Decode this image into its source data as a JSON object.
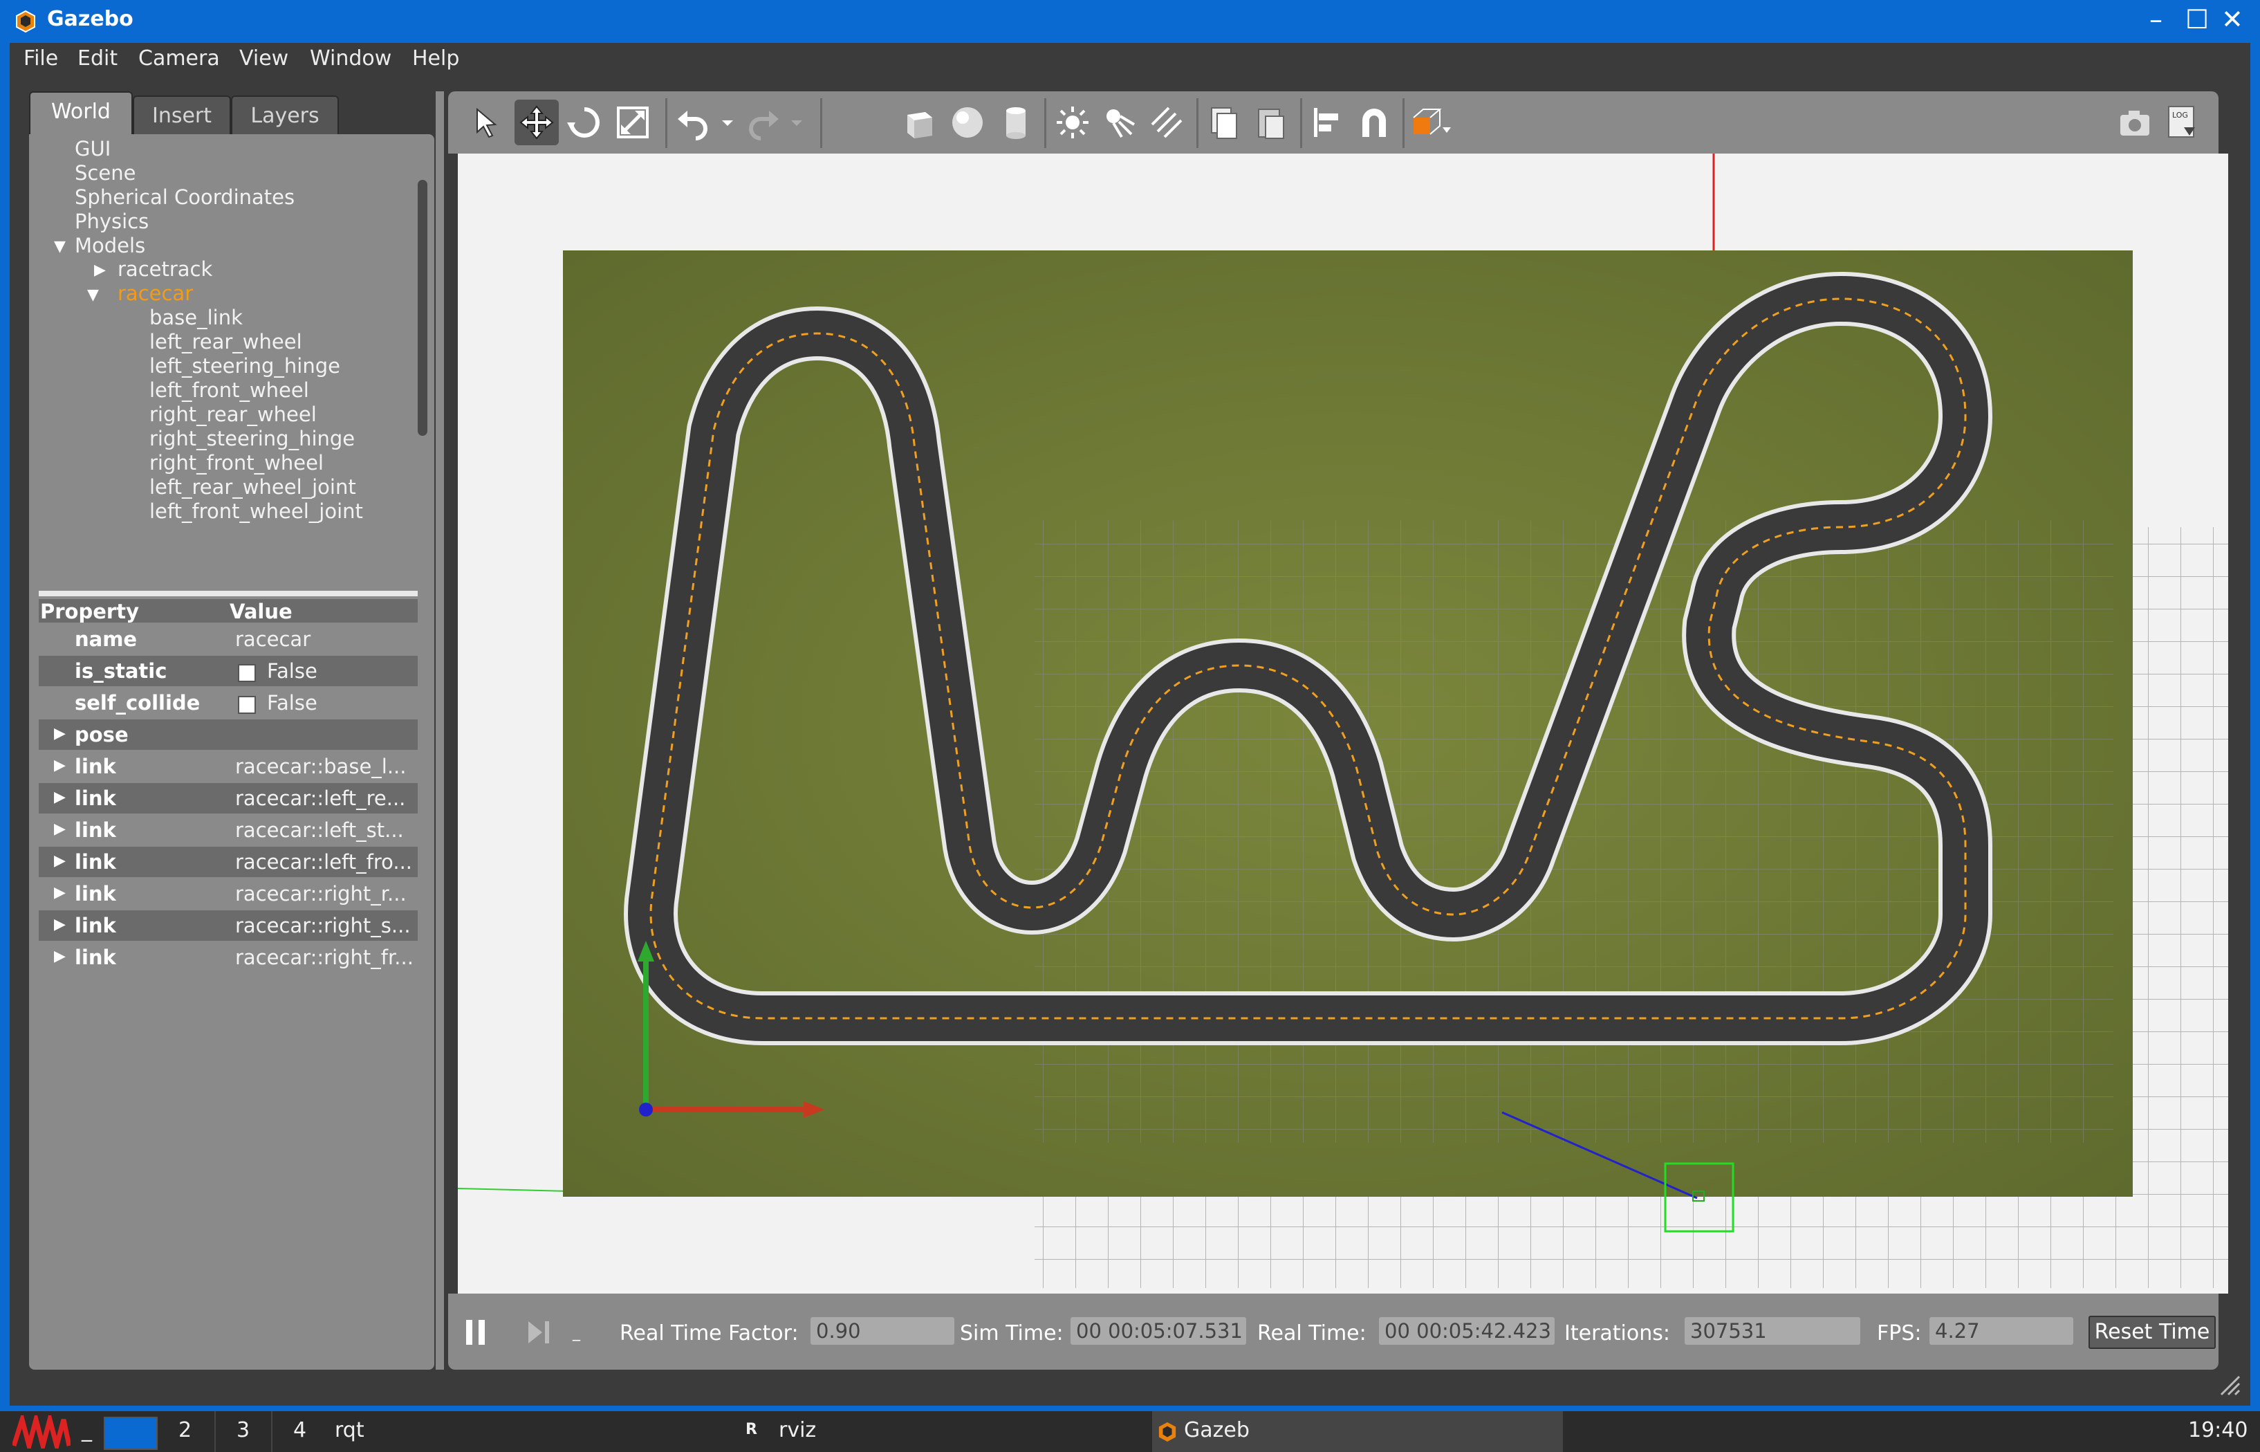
{
  "window": {
    "title": "Gazebo"
  },
  "menu": [
    "File",
    "Edit",
    "Camera",
    "View",
    "Window",
    "Help"
  ],
  "tabs": [
    "World",
    "Insert",
    "Layers"
  ],
  "tree": {
    "top": [
      "GUI",
      "Scene",
      "Spherical Coordinates",
      "Physics",
      "Models"
    ],
    "models": [
      "racetrack",
      "racecar"
    ],
    "racecar_children": [
      "base_link",
      "left_rear_wheel",
      "left_steering_hinge",
      "left_front_wheel",
      "right_rear_wheel",
      "right_steering_hinge",
      "right_front_wheel",
      "left_rear_wheel_joint",
      "left_front_wheel_joint"
    ]
  },
  "properties": {
    "header": {
      "property": "Property",
      "value": "Value"
    },
    "rows": [
      {
        "key": "name",
        "value": "racecar"
      },
      {
        "key": "is_static",
        "value": "False"
      },
      {
        "key": "self_collide",
        "value": "False"
      },
      {
        "key": "pose",
        "value": ""
      },
      {
        "key": "link",
        "value": "racecar::base_l..."
      },
      {
        "key": "link",
        "value": "racecar::left_re..."
      },
      {
        "key": "link",
        "value": "racecar::left_st..."
      },
      {
        "key": "link",
        "value": "racecar::left_fro..."
      },
      {
        "key": "link",
        "value": "racecar::right_r..."
      },
      {
        "key": "link",
        "value": "racecar::right_s..."
      },
      {
        "key": "link",
        "value": "racecar::right_fr..."
      }
    ]
  },
  "toolbar_icons": [
    "select-arrow-icon",
    "translate-icon",
    "rotate-icon",
    "scale-icon",
    "undo-icon",
    "undo-dropdown-icon",
    "redo-icon",
    "redo-dropdown-icon",
    "box-icon",
    "sphere-icon",
    "cylinder-icon",
    "point-light-icon",
    "spot-light-icon",
    "directional-light-icon",
    "copy-icon",
    "paste-icon",
    "align-icon",
    "snap-icon",
    "view-angle-icon",
    "screenshot-icon",
    "log-icon"
  ],
  "status": {
    "rtf_label": "Real Time Factor:",
    "rtf_value": "0.90",
    "sim_label": "Sim Time:",
    "sim_value": "00 00:05:07.531",
    "real_label": "Real Time:",
    "real_value": "00 00:05:42.423",
    "iter_label": "Iterations:",
    "iter_value": "307531",
    "fps_label": "FPS:",
    "fps_value": "4.27",
    "reset_label": "Reset Time"
  },
  "taskbar": {
    "workspaces": [
      "2",
      "3",
      "4"
    ],
    "tasks": [
      "rqt",
      "rviz",
      "Gazeb"
    ],
    "clock": "19:40",
    "minimize": "_"
  },
  "colors": {
    "titlebar": "#0a6ad1",
    "panel": "#8a8a8a",
    "selected": "#f39c12",
    "ground": "#6f7a36",
    "track": "#3a3a3a",
    "center_line": "#f0a020"
  }
}
